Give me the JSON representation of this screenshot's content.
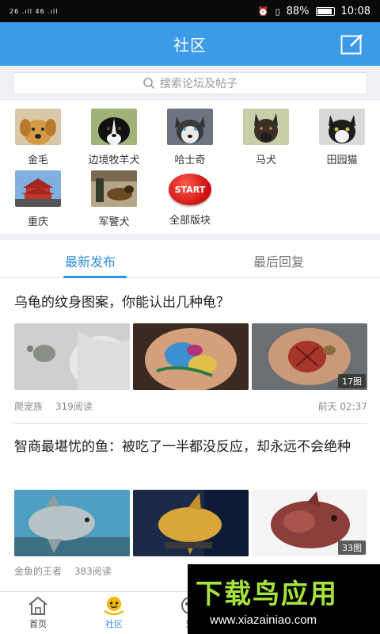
{
  "status_bar": {
    "signal_left": "26 .ıll 46 .ıll",
    "battery": "88%",
    "time": "10:08"
  },
  "header": {
    "title": "社区",
    "compose_icon": "compose-icon"
  },
  "search": {
    "placeholder": "搜索论坛及帖子"
  },
  "categories": [
    {
      "label": "金毛"
    },
    {
      "label": "边境牧羊犬"
    },
    {
      "label": "哈士奇"
    },
    {
      "label": "马犬"
    },
    {
      "label": "田园猫"
    },
    {
      "label": "重庆"
    },
    {
      "label": "军警犬"
    },
    {
      "label": "全部版块",
      "badge": "START"
    }
  ],
  "tabs": [
    {
      "label": "最新发布",
      "active": true
    },
    {
      "label": "最后回复",
      "active": false
    }
  ],
  "posts": [
    {
      "title": "乌龟的纹身图案，你能认出几种龟？",
      "image_count": "17图",
      "source": "爬宠族",
      "reads": "319阅读",
      "time": "前天 02:37"
    },
    {
      "title": "智商最堪忧的鱼：被吃了一半都没反应，却永远不会绝种",
      "image_count": "33图",
      "source": "金鱼的王者",
      "reads": "383阅读"
    }
  ],
  "bottom_nav": [
    {
      "label": "首页",
      "active": false
    },
    {
      "label": "社区",
      "active": true
    },
    {
      "label": "宠",
      "active": false
    }
  ],
  "watermark": {
    "brand": "下载鸟应用",
    "url": "www.xiazainiao.com"
  },
  "colors": {
    "primary": "#3d9ae8",
    "accent": "#2f8fe0",
    "background": "#eef0f3",
    "watermark_green": "#a6e43c"
  }
}
